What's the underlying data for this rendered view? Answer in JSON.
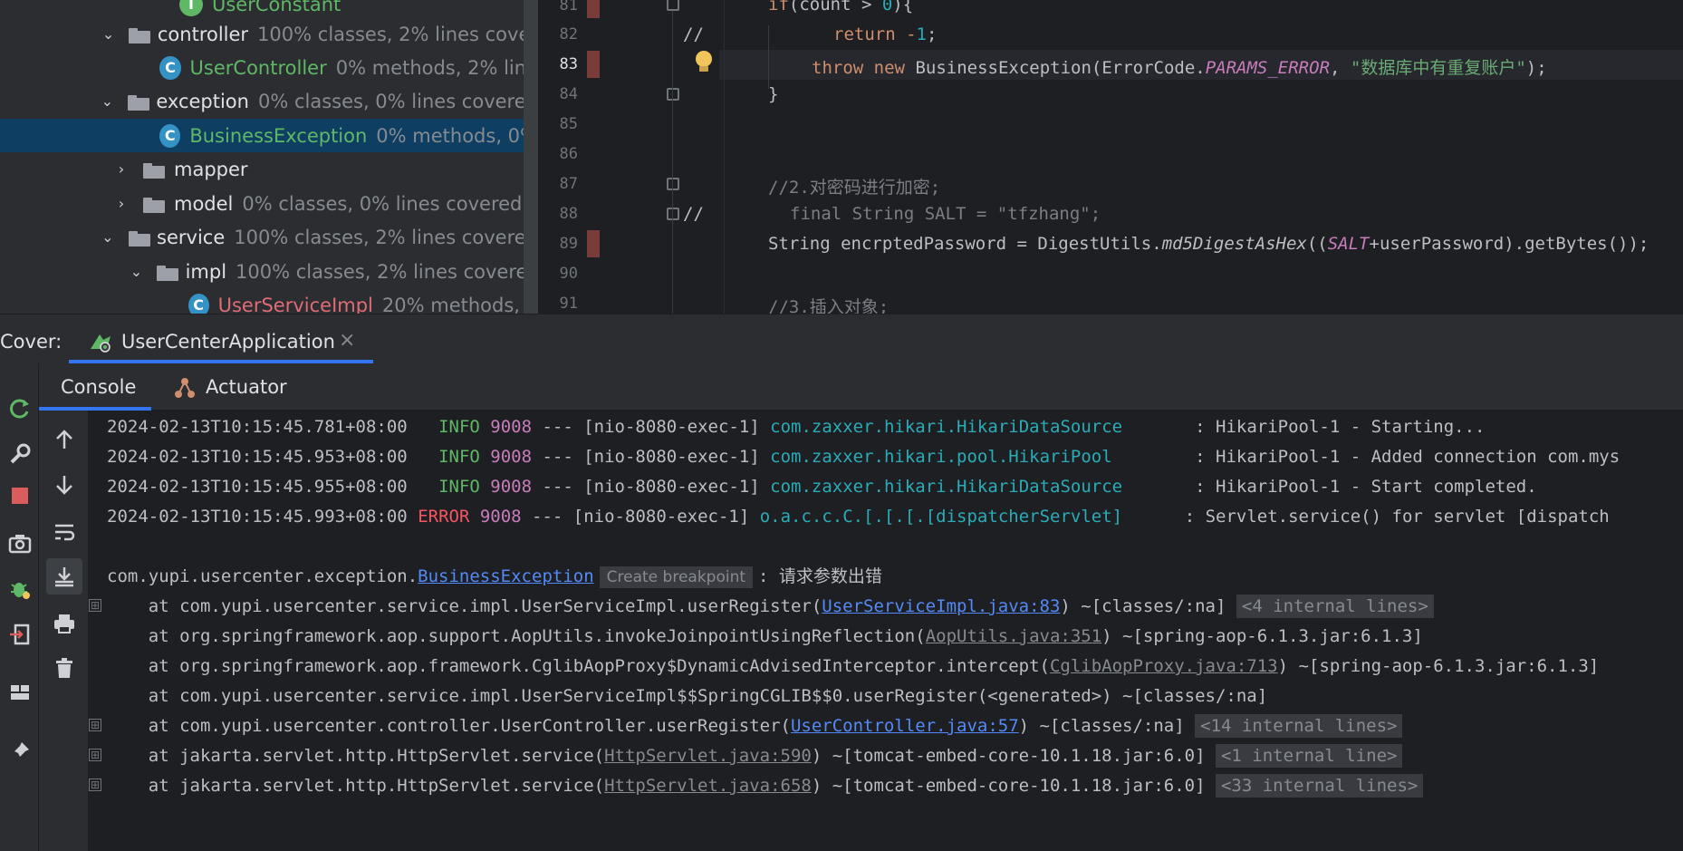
{
  "project_tree": {
    "rows": [
      {
        "name": "UserConstant",
        "meta": ""
      },
      {
        "name": "controller",
        "meta": "100% classes, 2% lines cover"
      },
      {
        "name": "UserController",
        "meta": "0% methods, 2% line"
      },
      {
        "name": "exception",
        "meta": "0% classes, 0% lines covered"
      },
      {
        "name": "BusinessException",
        "meta": "0% methods, 0%"
      },
      {
        "name": "mapper",
        "meta": ""
      },
      {
        "name": "model",
        "meta": "0% classes, 0% lines covered"
      },
      {
        "name": "service",
        "meta": "100% classes, 2% lines covered"
      },
      {
        "name": "impl",
        "meta": "100% classes, 2% lines coverec"
      },
      {
        "name": "UserServiceImpl",
        "meta": "20% methods, 2"
      }
    ],
    "class_icon_letter": "C"
  },
  "editor": {
    "line_numbers": [
      "81",
      "82",
      "83",
      "84",
      "85",
      "86",
      "87",
      "88",
      "89",
      "90",
      "91"
    ],
    "current_line": "83",
    "lines": {
      "l81": {
        "kw1": "if",
        "a": "(count > ",
        "n": "0",
        "b": "){"
      },
      "l82": {
        "prefix": "//",
        "a": "return -",
        "n": "1",
        "b": ";"
      },
      "l83": {
        "kw1": "throw",
        "kw2": "new",
        "a": "BusinessException(ErrorCode.",
        "it": "PARAMS_ERROR",
        "b": ", ",
        "st": "\"数据库中有重复账户\"",
        "c": ");"
      },
      "l84": {
        "a": "}"
      },
      "l87": {
        "cm": "//2.对密码进行加密;"
      },
      "l88": {
        "prefix": "//",
        "a": "final String SALT = \"tfzhang\";"
      },
      "l89": {
        "a": "String encrptedPassword = DigestUtils.",
        "fn": "md5DigestAsHex",
        "b": "((",
        "it": "SALT",
        "c": "+userPassword).getBytes());"
      },
      "l91": {
        "cm": "//3.插入对象;"
      }
    }
  },
  "cover_bar": {
    "label": "Cover:",
    "tab_title": "UserCenterApplication",
    "close_glyph": "×"
  },
  "console_tabs": {
    "console": "Console",
    "actuator": "Actuator"
  },
  "console": {
    "logs": [
      {
        "ts": "2024-02-13T10:15:45.781+08:00",
        "level": " INFO",
        "pid": "9008",
        "thread": " --- [nio-8080-exec-1] ",
        "logger": "com.zaxxer.hikari.HikariDataSource      ",
        "msg": " : HikariPool-1 - Starting..."
      },
      {
        "ts": "2024-02-13T10:15:45.953+08:00",
        "level": " INFO",
        "pid": "9008",
        "thread": " --- [nio-8080-exec-1] ",
        "logger": "com.zaxxer.hikari.pool.HikariPool       ",
        "msg": " : HikariPool-1 - Added connection com.mys"
      },
      {
        "ts": "2024-02-13T10:15:45.955+08:00",
        "level": " INFO",
        "pid": "9008",
        "thread": " --- [nio-8080-exec-1] ",
        "logger": "com.zaxxer.hikari.HikariDataSource      ",
        "msg": " : HikariPool-1 - Start completed."
      },
      {
        "ts": "2024-02-13T10:15:45.993+08:00",
        "level": "ERROR",
        "pid": "9008",
        "thread": " --- [nio-8080-exec-1] ",
        "logger": "o.a.c.c.C.[.[.[.[dispatcherServlet]     ",
        "msg": " : Servlet.service() for servlet [dispatch"
      }
    ],
    "exception": {
      "pkg": "com.yupi.usercenter.exception.",
      "cls": "BusinessException",
      "bp": "Create breakpoint",
      "msg": ": 请求参数出错"
    },
    "stack": [
      {
        "pre": "    at com.yupi.usercenter.service.impl.UserServiceImpl.userRegister(",
        "link": "UserServiceImpl.java:83",
        "post": ") ~[classes/:na] ",
        "inl": "<4 internal lines>",
        "link_style": "project",
        "expander": "⊞"
      },
      {
        "pre": "    at org.springframework.aop.support.AopUtils.invokeJoinpointUsingReflection(",
        "link": "AopUtils.java:351",
        "post": ") ~[spring-aop-6.1.3.jar:6.1.3]",
        "inl": "",
        "link_style": "library",
        "expander": ""
      },
      {
        "pre": "    at org.springframework.aop.framework.CglibAopProxy$DynamicAdvisedInterceptor.intercept(",
        "link": "CglibAopProxy.java:713",
        "post": ") ~[spring-aop-6.1.3.jar:6.1.3]",
        "inl": "",
        "link_style": "library",
        "expander": ""
      },
      {
        "pre": "    at com.yupi.usercenter.service.impl.UserServiceImpl$$SpringCGLIB$$0.userRegister(<generated>) ~[classes/:na]",
        "link": "",
        "post": "",
        "inl": "",
        "link_style": "none",
        "expander": ""
      },
      {
        "pre": "    at com.yupi.usercenter.controller.UserController.userRegister(",
        "link": "UserController.java:57",
        "post": ") ~[classes/:na] ",
        "inl": "<14 internal lines>",
        "link_style": "project",
        "expander": "⊞"
      },
      {
        "pre": "    at jakarta.servlet.http.HttpServlet.service(",
        "link": "HttpServlet.java:590",
        "post": ") ~[tomcat-embed-core-10.1.18.jar:6.0] ",
        "inl": "<1 internal line>",
        "link_style": "library",
        "expander": "⊞"
      },
      {
        "pre": "    at jakarta.servlet.http.HttpServlet.service(",
        "link": "HttpServlet.java:658",
        "post": ") ~[tomcat-embed-core-10.1.18.jar:6.0] ",
        "inl": "<33 internal lines>",
        "link_style": "library",
        "expander": "⊞"
      }
    ]
  },
  "tools": {
    "left": [
      "rerun-icon",
      "wrench-icon",
      "stop-icon",
      "camera-icon",
      "debug-icon",
      "exit-icon",
      "layout-icon",
      "pin-icon"
    ],
    "console": [
      "up-arrow-icon",
      "down-arrow-icon",
      "soft-wrap-icon",
      "scroll-to-end-icon",
      "print-icon",
      "trash-icon"
    ]
  },
  "colors": {
    "accent": "#3574f0",
    "selection": "#0e3f63",
    "info": "#5fb865",
    "error": "#f75464",
    "link": "#548af7",
    "coverage_miss": "#7a3b3b"
  }
}
